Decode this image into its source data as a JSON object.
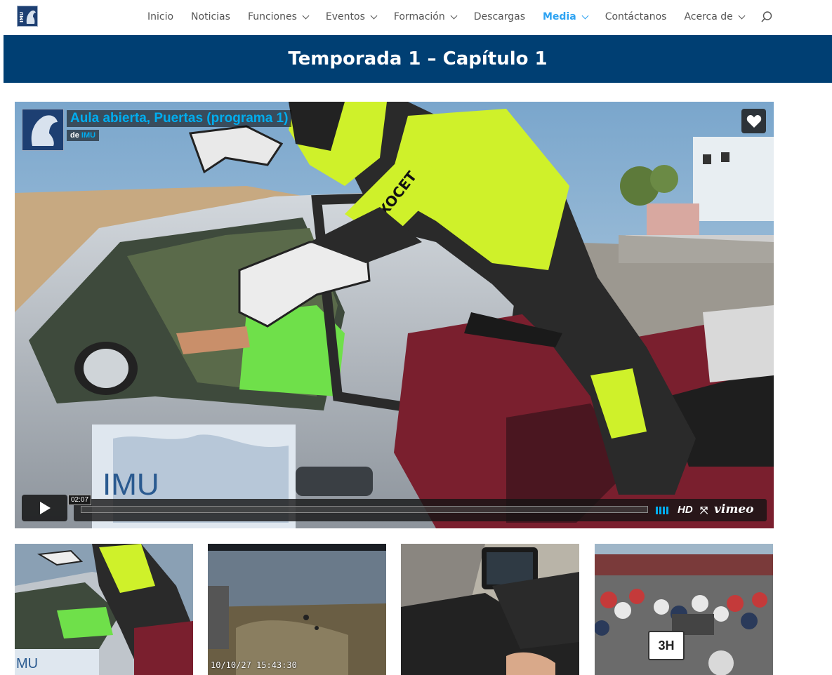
{
  "site": {
    "logo_text": "IMU"
  },
  "nav": {
    "items": [
      {
        "label": "Inicio",
        "has_dropdown": false,
        "active": false
      },
      {
        "label": "Noticias",
        "has_dropdown": false,
        "active": false
      },
      {
        "label": "Funciones",
        "has_dropdown": true,
        "active": false
      },
      {
        "label": "Eventos",
        "has_dropdown": true,
        "active": false
      },
      {
        "label": "Formación",
        "has_dropdown": true,
        "active": false
      },
      {
        "label": "Descargas",
        "has_dropdown": false,
        "active": false
      },
      {
        "label": "Media",
        "has_dropdown": true,
        "active": true
      },
      {
        "label": "Contáctanos",
        "has_dropdown": false,
        "active": false
      },
      {
        "label": "Acerca de",
        "has_dropdown": true,
        "active": false
      }
    ],
    "search_icon": "search-icon"
  },
  "page": {
    "title": "Temporada 1 – Capítulo 1"
  },
  "video": {
    "title": "Aula abierta, Puertas (programa 1)",
    "by_prefix": "de",
    "by_author": "IMU",
    "duration": "02:07",
    "hd_label": "HD",
    "provider": "vimeo",
    "car_logo": "IMU",
    "jacket_text": "EXOCET",
    "icons": [
      "heart-icon",
      "play-icon",
      "volume-icon",
      "fullscreen-icon"
    ]
  },
  "thumbnails": [
    {
      "name": "thumb-1",
      "caption": "MU"
    },
    {
      "name": "thumb-2",
      "caption": "10/10/27 15:43:30"
    },
    {
      "name": "thumb-3",
      "caption": ""
    },
    {
      "name": "thumb-4",
      "caption": "3H"
    }
  ],
  "colors": {
    "banner": "#003f73",
    "accent": "#2ea3f2",
    "vimeo_blue": "#00adef",
    "nav_text": "#555555"
  }
}
